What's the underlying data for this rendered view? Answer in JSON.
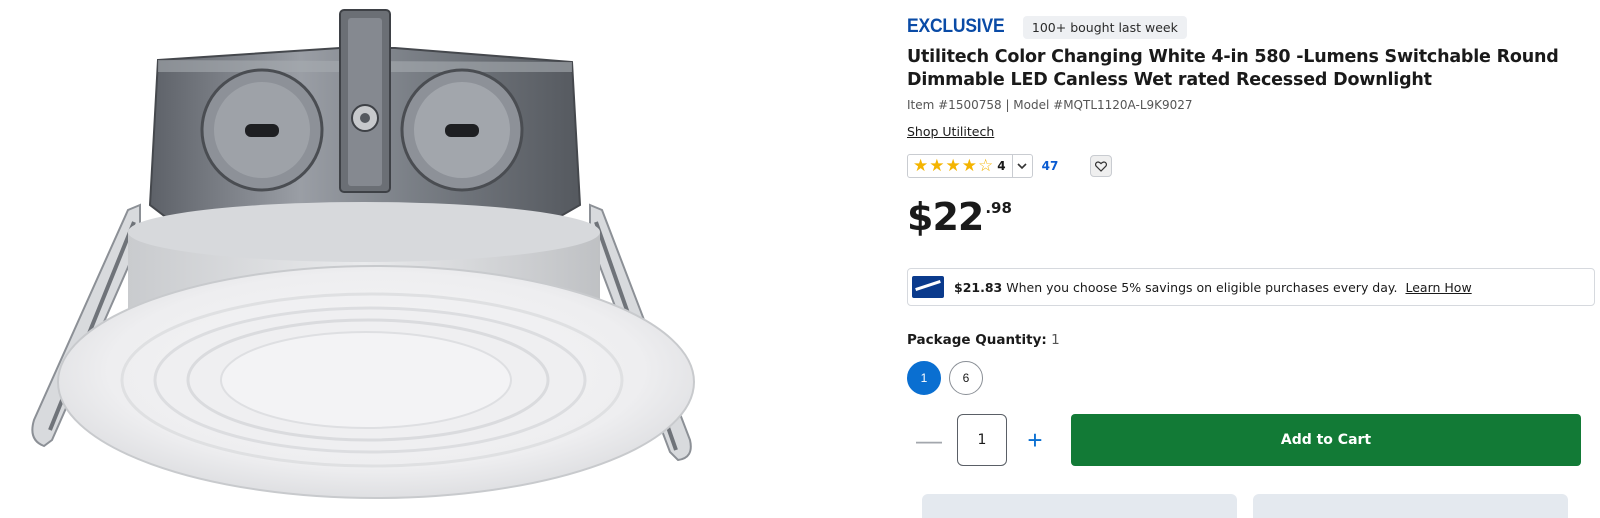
{
  "badges": {
    "exclusive": "EXCLUSIVE",
    "bought": "100+ bought last week"
  },
  "product": {
    "title": "Utilitech Color Changing White 4-in 580 -Lumens Switchable Round Dimmable LED Canless Wet rated Recessed Downlight",
    "item_model": "Item #1500758 | Model #MQTL1120A-L9K9027",
    "shop_link": "Shop Utilitech"
  },
  "rating": {
    "stars_filled": 4,
    "stars_total": 5,
    "value": "4",
    "review_count": "47"
  },
  "price": {
    "main": "$22",
    "cents": ".98"
  },
  "savings": {
    "amount": "$21.83",
    "text": "When you choose 5% savings on eligible purchases every day.",
    "link": "Learn How"
  },
  "package": {
    "label": "Package Quantity:",
    "value": "1",
    "options": [
      "1",
      "6"
    ],
    "selected": "1"
  },
  "cart": {
    "minus": "—",
    "plus": "+",
    "quantity": "1",
    "add_label": "Add to Cart"
  },
  "icons": {
    "chevron": "chevron-down-icon",
    "favorite": "heart-icon",
    "card": "credit-card-icon"
  },
  "colors": {
    "brand_blue": "#0a4ba6",
    "selected_blue": "#0a6fd1",
    "cart_green": "#127a36",
    "star_gold": "#f4b400"
  }
}
